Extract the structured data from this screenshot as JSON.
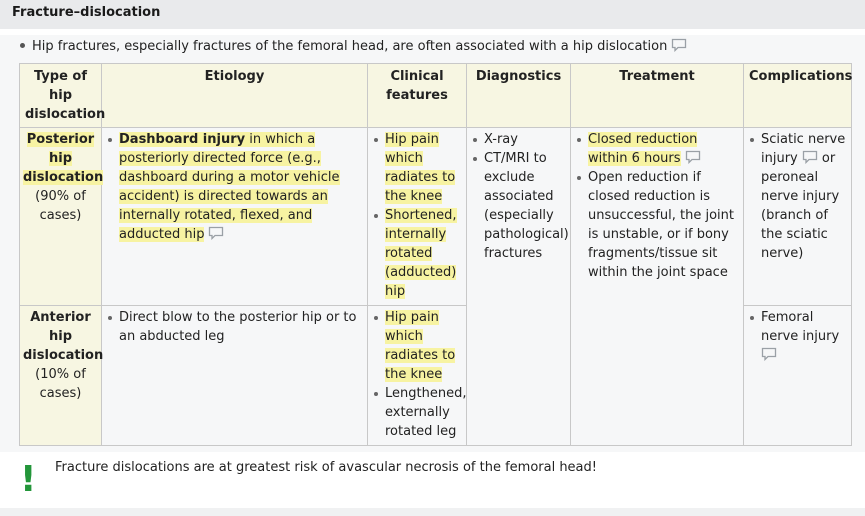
{
  "section_title": "Fracture–dislocation",
  "intro_text": "Hip fractures, especially fractures of the femoral head, are often associated with a hip dislocation",
  "table": {
    "headers": [
      "Type of hip dislocation",
      "Etiology",
      "Clinical features",
      "Diagnostics",
      "Treatment",
      "Complications"
    ],
    "posterior": {
      "name": "Posterior hip dislocation",
      "pct": "(90% of cases)",
      "etiology_bold": "Dashboard injury",
      "etiology_rest": " in which a posteriorly directed force (e.g., dashboard during a motor vehicle accident) is directed towards an internally rotated, flexed, and adducted hip",
      "clinical": [
        "Hip pain which radiates to the knee",
        "Shortened, internally rotated (adducted) hip"
      ],
      "complications": {
        "a": "Sciatic nerve injury",
        "b": " or peroneal nerve injury (branch of the sciatic nerve)"
      }
    },
    "diagnostics": [
      "X-ray",
      "CT/MRI to exclude associated (especially pathological) fractures"
    ],
    "treatment": {
      "first": "Closed reduction within 6 hours",
      "second": "Open reduction if closed reduction is unsuccessful, the joint is unstable, or if bony fragments/tissue sit within the joint space"
    },
    "anterior": {
      "name": "Anterior hip dislocation",
      "pct": "(10% of cases)",
      "etiology": "Direct blow to the posterior hip or to an abducted leg",
      "clinical_hl": "Hip pain which radiates to the knee",
      "clinical_plain": "Lengthened, externally rotated leg",
      "complications": "Femoral nerve injury"
    }
  },
  "callout_symbol": "!",
  "callout_text": "Fracture dislocations are at greatest risk of avascular necrosis of the femoral head!",
  "colors": {
    "highlight": "#f7f3a2",
    "header_bg": "#f7f6e2",
    "callout_green": "#23963a"
  }
}
